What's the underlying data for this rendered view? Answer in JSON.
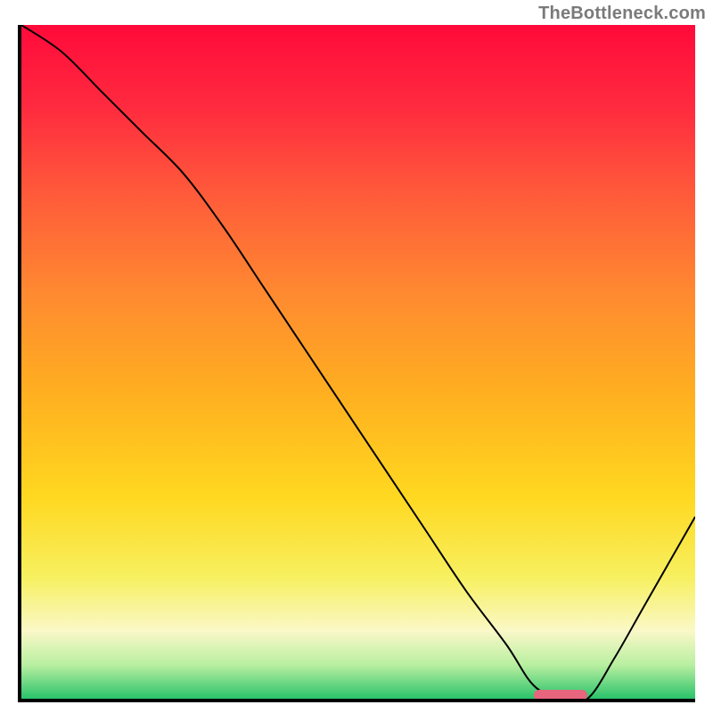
{
  "watermark": "TheBottleneck.com",
  "chart_data": {
    "type": "line",
    "title": "",
    "xlabel": "",
    "ylabel": "",
    "xlim": [
      0,
      100
    ],
    "ylim": [
      0,
      100
    ],
    "x": [
      0,
      6,
      12,
      18,
      24,
      30,
      36,
      42,
      48,
      54,
      60,
      66,
      72,
      76,
      80,
      84,
      88,
      92,
      96,
      100
    ],
    "values": [
      100,
      96,
      90,
      84,
      78,
      70,
      61,
      52,
      43,
      34,
      25,
      16,
      8,
      2,
      0,
      0,
      6,
      13,
      20,
      27
    ],
    "gradient_bands": [
      {
        "pos": 0.0,
        "color": "#ff0a3a"
      },
      {
        "pos": 0.12,
        "color": "#ff2a3f"
      },
      {
        "pos": 0.25,
        "color": "#ff5a3a"
      },
      {
        "pos": 0.4,
        "color": "#ff8a30"
      },
      {
        "pos": 0.55,
        "color": "#ffb020"
      },
      {
        "pos": 0.7,
        "color": "#ffd820"
      },
      {
        "pos": 0.82,
        "color": "#f7f060"
      },
      {
        "pos": 0.9,
        "color": "#faf8c8"
      },
      {
        "pos": 0.95,
        "color": "#b8efa0"
      },
      {
        "pos": 1.0,
        "color": "#2ac26b"
      }
    ],
    "marker": {
      "x_start": 76,
      "x_end": 84,
      "y": 0.5,
      "color": "#e8657e"
    },
    "line_color": "#000000",
    "line_width": 2
  }
}
